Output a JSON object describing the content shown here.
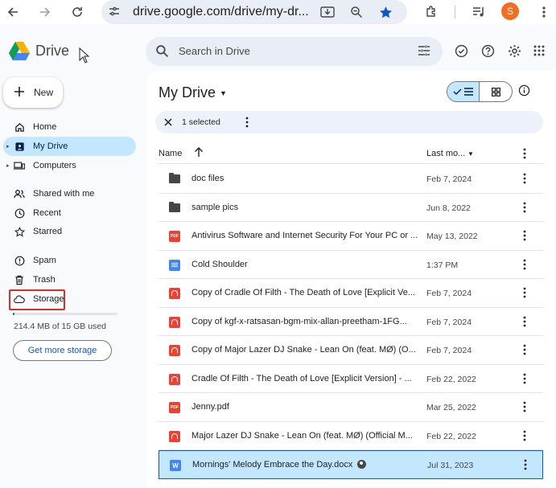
{
  "browser": {
    "url": "drive.google.com/drive/my-dr...",
    "avatar_letter": "S"
  },
  "app": {
    "name": "Drive",
    "search_placeholder": "Search in Drive"
  },
  "sidebar": {
    "new_label": "New",
    "items": [
      {
        "label": "Home",
        "icon": "home-icon"
      },
      {
        "label": "My Drive",
        "icon": "my-drive-icon",
        "active": true
      },
      {
        "label": "Computers",
        "icon": "computers-icon"
      },
      {
        "label": "Shared with me",
        "icon": "shared-icon"
      },
      {
        "label": "Recent",
        "icon": "clock-icon"
      },
      {
        "label": "Starred",
        "icon": "star-icon"
      },
      {
        "label": "Spam",
        "icon": "spam-icon"
      },
      {
        "label": "Trash",
        "icon": "trash-icon"
      },
      {
        "label": "Storage",
        "icon": "cloud-icon"
      }
    ],
    "quota_text": "214.4 MB of 15 GB used",
    "quota_fraction": 0.014,
    "get_storage_label": "Get more storage"
  },
  "main": {
    "title": "My Drive",
    "selection_text": "1 selected",
    "columns": {
      "name": "Name",
      "modified": "Last mo..."
    },
    "files": [
      {
        "name": "doc files",
        "date": "Feb 7, 2024",
        "type": "folder"
      },
      {
        "name": "sample pics",
        "date": "Jun 8, 2022",
        "type": "folder"
      },
      {
        "name": "Antivirus Software and Internet Security For Your PC or ...",
        "date": "May 13, 2022",
        "type": "pdf"
      },
      {
        "name": "Cold Shoulder",
        "date": "1:37 PM",
        "type": "doc"
      },
      {
        "name": "Copy of Cradle Of Filth - The Death of Love [Explicit Ve...",
        "date": "Feb 7, 2024",
        "type": "audio"
      },
      {
        "name": "Copy of kgf-x-ratsasan-bgm-mix-allan-preetham-1FG...",
        "date": "Feb 7, 2024",
        "type": "audio"
      },
      {
        "name": "Copy of Major Lazer  DJ Snake - Lean On (feat. MØ) (O...",
        "date": "Feb 7, 2024",
        "type": "audio"
      },
      {
        "name": "Cradle Of Filth - The Death of Love [Explicit Version] - ...",
        "date": "Feb 22, 2022",
        "type": "audio"
      },
      {
        "name": "Jenny.pdf",
        "date": "Mar 25, 2022",
        "type": "pdf"
      },
      {
        "name": "Major Lazer  DJ Snake - Lean On (feat. MØ) (Official M...",
        "date": "Feb 22, 2022",
        "type": "audio"
      },
      {
        "name": "Mornings' Melody Embrace the Day.docx",
        "date": "Jul 31, 2023",
        "type": "word",
        "selected": true,
        "shared": true
      }
    ]
  }
}
